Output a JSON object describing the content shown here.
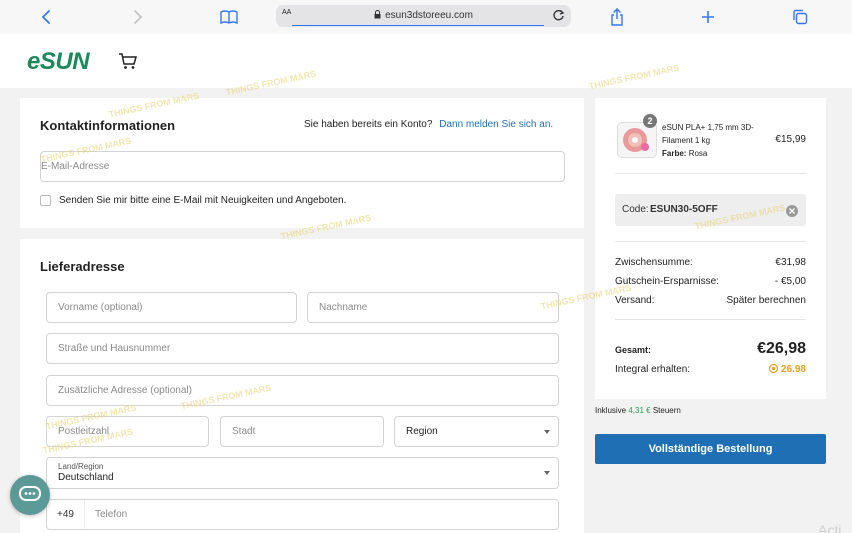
{
  "browser": {
    "aa_label": "AA",
    "url": "esun3dstoreeu.com"
  },
  "site": {
    "logo": "eSUN"
  },
  "contact": {
    "title": "Kontaktinformationen",
    "account_prompt": "Sie haben bereits ein Konto?",
    "login_link": "Dann melden Sie sich an.",
    "email_placeholder": "E-Mail-Adresse",
    "newsletter_label": "Senden Sie mir bitte eine E-Mail mit Neuigkeiten und Angeboten."
  },
  "shipping": {
    "title": "Lieferadresse",
    "first_name_placeholder": "Vorname (optional)",
    "last_name_placeholder": "Nachname",
    "street_placeholder": "Straße und Hausnummer",
    "additional_placeholder": "Zusätzliche Adresse (optional)",
    "postal_placeholder": "Postleitzahl",
    "city_placeholder": "Stadt",
    "region_value": "Region",
    "country_label": "Land/Region",
    "country_value": "Deutschland",
    "phone_prefix": "+49",
    "phone_placeholder": "Telefon"
  },
  "summary": {
    "item_quantity": "2",
    "item_name_line1": "eSUN PLA+ 1,75 mm 3D-",
    "item_name_line2": "Filament 1 kg",
    "item_color_label": "Farbe:",
    "item_color_value": "Rosa",
    "item_price": "€15,99",
    "coupon_label": "Code:",
    "coupon_code": "ESUN30-5OFF",
    "subtotal_label": "Zwischensumme:",
    "subtotal_value": "€31,98",
    "discount_label": "Gutschein-Ersparnisse:",
    "discount_value": "- €5,00",
    "shipping_label": "Versand:",
    "shipping_value": "Später berechnen",
    "total_label": "Gesamt:",
    "total_value": "€26,98",
    "points_label": "Integral erhalten:",
    "points_value": "26.98",
    "tax_prefix": "Inklusive",
    "tax_value": "4,31 €",
    "tax_suffix": "Steuern",
    "checkout_button": "Vollständige Bestellung"
  },
  "watermark_text": "THINGS FROM MARS",
  "faded_corner_text": "Acti",
  "colors": {
    "brand_green": "#1a8a5a",
    "link_blue": "#1f6fb5",
    "points_orange": "#e8a020",
    "tax_green": "#2a9a55"
  }
}
